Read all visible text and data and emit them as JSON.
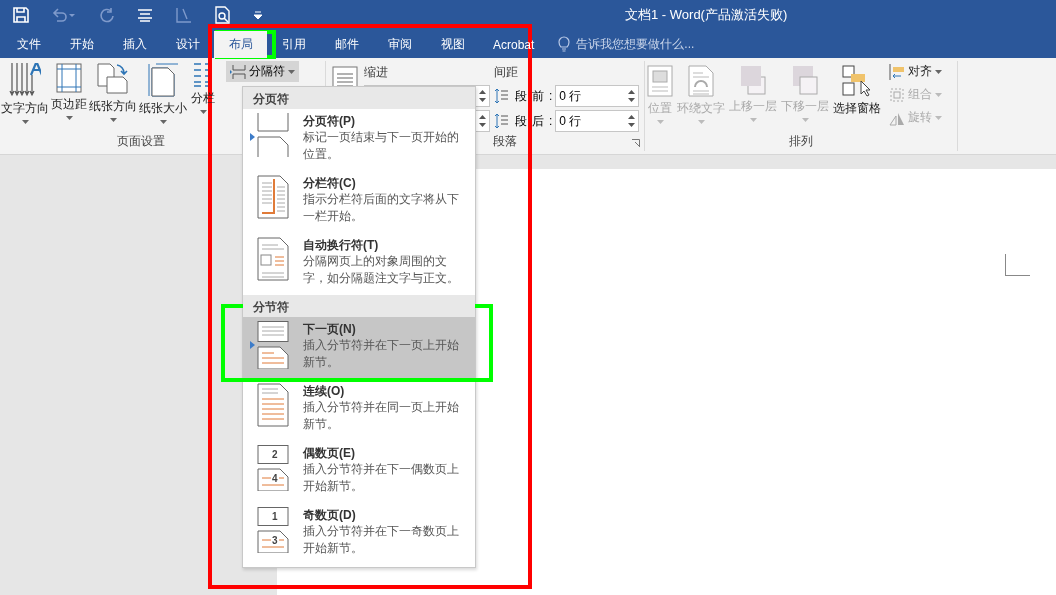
{
  "window": {
    "title": "文档1 - Word(产品激活失败)"
  },
  "tabs": [
    {
      "label": "文件",
      "selected": false
    },
    {
      "label": "开始",
      "selected": false
    },
    {
      "label": "插入",
      "selected": false
    },
    {
      "label": "设计",
      "selected": false
    },
    {
      "label": "布局",
      "selected": true
    },
    {
      "label": "引用",
      "selected": false
    },
    {
      "label": "邮件",
      "selected": false
    },
    {
      "label": "审阅",
      "selected": false
    },
    {
      "label": "视图",
      "selected": false
    },
    {
      "label": "Acrobat",
      "selected": false
    }
  ],
  "tell_me": {
    "placeholder": "告诉我您想要做什么..."
  },
  "page_setup": {
    "label": "页面设置",
    "buttons": [
      {
        "kind": "text-direction",
        "label": "文字方向"
      },
      {
        "kind": "margins",
        "label": "页边距"
      },
      {
        "kind": "orientation",
        "label": "纸张方向"
      },
      {
        "kind": "size",
        "label": "纸张大小"
      },
      {
        "kind": "columns",
        "label": "分栏"
      }
    ],
    "breaks": {
      "label": "分隔符",
      "selected": true
    }
  },
  "paragraph": {
    "label": "段落",
    "indent_label": "缩进",
    "spacing_label": "间距",
    "spacing": [
      {
        "label": "段前:",
        "value": "0 行"
      },
      {
        "label": "段后:",
        "value": "0 行"
      }
    ]
  },
  "arrange": {
    "label": "排列",
    "buttons": [
      {
        "kind": "position",
        "label": "位置",
        "disabled": true
      },
      {
        "kind": "wrap",
        "label": "环绕文字",
        "disabled": true
      },
      {
        "kind": "forward",
        "label": "上移一层",
        "disabled": true
      },
      {
        "kind": "backward",
        "label": "下移一层",
        "disabled": true
      },
      {
        "kind": "pane",
        "label": "选择窗格",
        "disabled": false
      }
    ],
    "small_buttons": [
      {
        "kind": "align",
        "label": "对齐",
        "disabled": false
      },
      {
        "kind": "group",
        "label": "组合",
        "disabled": true
      },
      {
        "kind": "rotate",
        "label": "旋转",
        "disabled": true
      }
    ]
  },
  "menu": {
    "sections": [
      {
        "heading": "分页符",
        "items": [
          {
            "kind": "page",
            "title": "分页符(P)",
            "description": "标记一页结束与下一页开始的位置。",
            "selected": false
          },
          {
            "kind": "column",
            "title": "分栏符(C)",
            "description": "指示分栏符后面的文字将从下一栏开始。",
            "selected": false
          },
          {
            "kind": "wrap",
            "title": "自动换行符(T)",
            "description": "分隔网页上的对象周围的文字，如分隔题注文字与正文。",
            "selected": false
          }
        ]
      },
      {
        "heading": "分节符",
        "items": [
          {
            "kind": "next",
            "title": "下一页(N)",
            "description": "插入分节符并在下一页上开始新节。",
            "selected": true
          },
          {
            "kind": "continuous",
            "title": "连续(O)",
            "description": "插入分节符并在同一页上开始新节。",
            "selected": false
          },
          {
            "kind": "even",
            "title": "偶数页(E)",
            "description": "插入分节符并在下一偶数页上开始新节。",
            "selected": false,
            "icon_digits": [
              "2",
              "4"
            ]
          },
          {
            "kind": "odd",
            "title": "奇数页(D)",
            "description": "插入分节符并在下一奇数页上开始新节。",
            "selected": false,
            "icon_digits": [
              "1",
              "3"
            ]
          }
        ]
      }
    ]
  },
  "annotations": [
    {
      "kind": "menu-frame",
      "color": "#ff0000"
    },
    {
      "kind": "tab-frame",
      "color": "#00ff00"
    },
    {
      "kind": "item-frame",
      "color": "#00ff00"
    }
  ]
}
